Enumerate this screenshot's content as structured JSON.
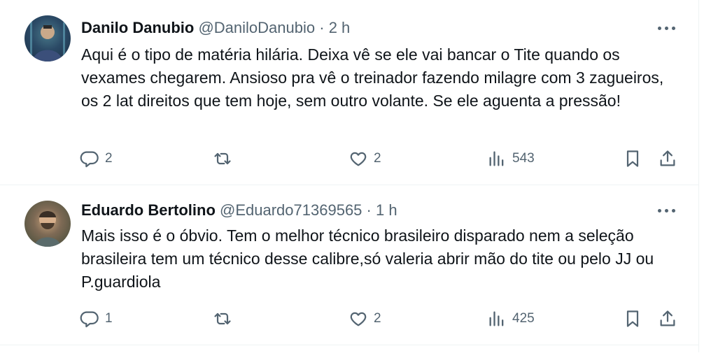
{
  "tweets": [
    {
      "author_name": "Danilo Danubio",
      "author_handle": "@DaniloDanubio",
      "separator": "·",
      "time": "2 h",
      "text": "Aqui é o tipo de matéria hilária. Deixa vê se ele vai bancar o Tite quando os vexames chegarem. Ansioso pra vê o treinador fazendo milagre com 3 zagueiros, os 2 lat direitos que tem hoje, sem outro volante. Se ele aguenta a pressão!",
      "replies": "2",
      "retweets": "",
      "likes": "2",
      "views": "543",
      "avatar_icon": "user-avatar"
    },
    {
      "author_name": "Eduardo Bertolino",
      "author_handle": "@Eduardo71369565",
      "separator": "·",
      "time": "1 h",
      "text": "Mais isso é o óbvio. Tem o melhor técnico brasileiro disparado nem a seleção brasileira tem um técnico desse calibre,só valeria abrir mão do tite ou pelo JJ ou P.guardiola",
      "replies": "1",
      "retweets": "",
      "likes": "2",
      "views": "425",
      "avatar_icon": "user-avatar"
    }
  ],
  "icons": {
    "reply": "reply-icon",
    "retweet": "retweet-icon",
    "like": "heart-icon",
    "views": "views-chart-icon",
    "bookmark": "bookmark-icon",
    "share": "share-icon",
    "more": "more-icon"
  },
  "colors": {
    "text": "#0f1419",
    "secondary": "#536471",
    "divider": "#eff3f4"
  }
}
